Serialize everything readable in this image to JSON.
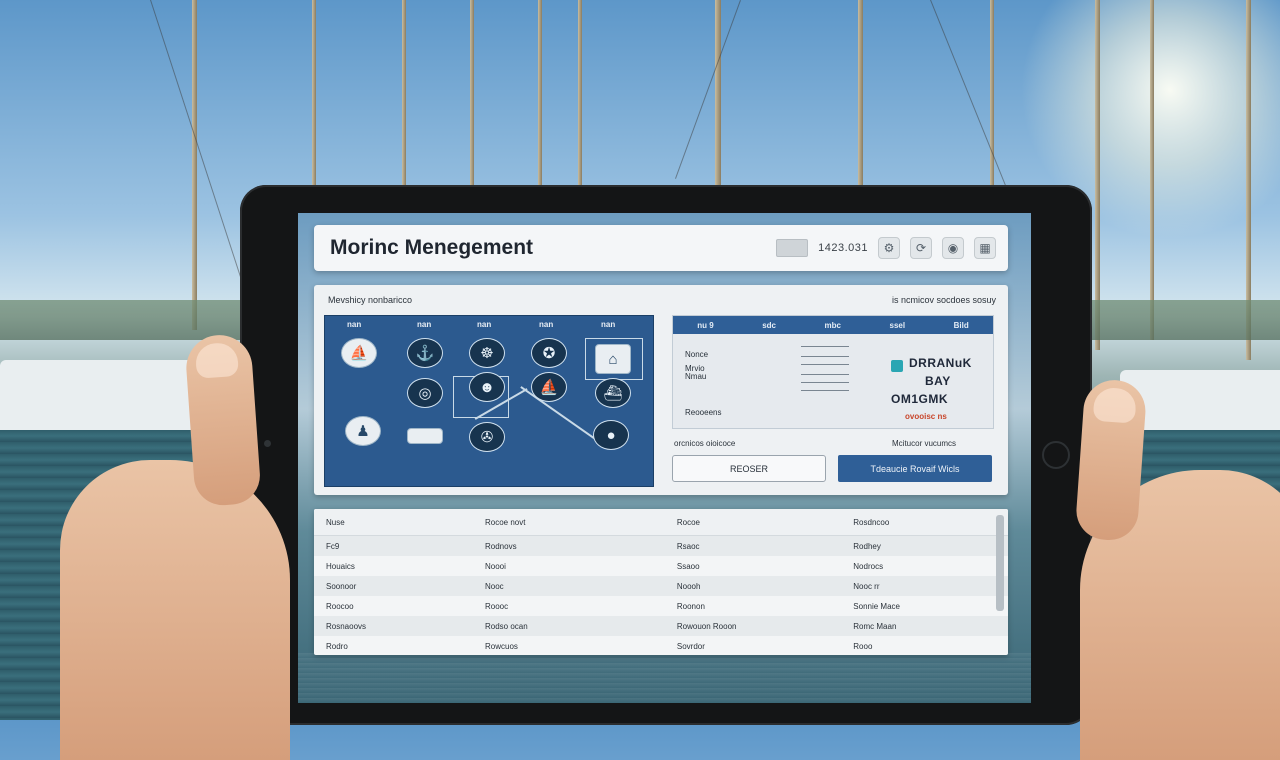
{
  "app": {
    "title": "Morinc Menegement",
    "header_code": "1423.031",
    "header_icons": [
      "settings-icon",
      "sync-icon",
      "user-icon",
      "grid-icon"
    ]
  },
  "dashboard": {
    "left_title": "Mevshicy nonbaricco",
    "right_title": "is ncmicov socdoes sosuy",
    "grid_columns": [
      "nan",
      "nan",
      "nan",
      "nan",
      "nan"
    ],
    "info": {
      "tabs": [
        "nu 9",
        "sdc",
        "mbc",
        "ssel",
        "Bild"
      ],
      "rows": [
        "Nonce",
        "Mrvio",
        "Nmau",
        "Reooeens"
      ],
      "big_lines": [
        "DRRANuK",
        "BAY",
        "OM1GMK"
      ],
      "small_line": "ovooisc ns"
    },
    "label_left": "orcnicos oioicoce",
    "label_right": "Mcitucor vucumcs",
    "button_secondary": "REOSER",
    "button_primary": "Tdeaucie Rovaif Wicls"
  },
  "table": {
    "headers": [
      "Nuse",
      "Rocoe novt",
      "Rocoe",
      "Rosdncoo"
    ],
    "rows": [
      [
        "Fc9",
        "Rodnovs",
        "Rsaoc",
        "Rodhey"
      ],
      [
        "Houaics",
        "Noooi",
        "Ssaoo",
        "Nodrocs"
      ],
      [
        "Soonoor",
        "Nooc",
        "Noooh",
        "Nooc rr"
      ],
      [
        "Roocoo",
        "Roooc",
        "Roonon",
        "Sonnie Mace"
      ],
      [
        "Rosnaoovs",
        "Rodso ocan",
        "Rowouon Rooon",
        "Romc Maan"
      ],
      [
        "Rodro",
        "Rowcuos",
        "Sovrdor",
        "Rooo"
      ]
    ]
  },
  "colors": {
    "accent": "#2f5f97",
    "header_bg": "#f4f6f8",
    "alert": "#c8462b",
    "indicator": "#2aa6b3"
  }
}
